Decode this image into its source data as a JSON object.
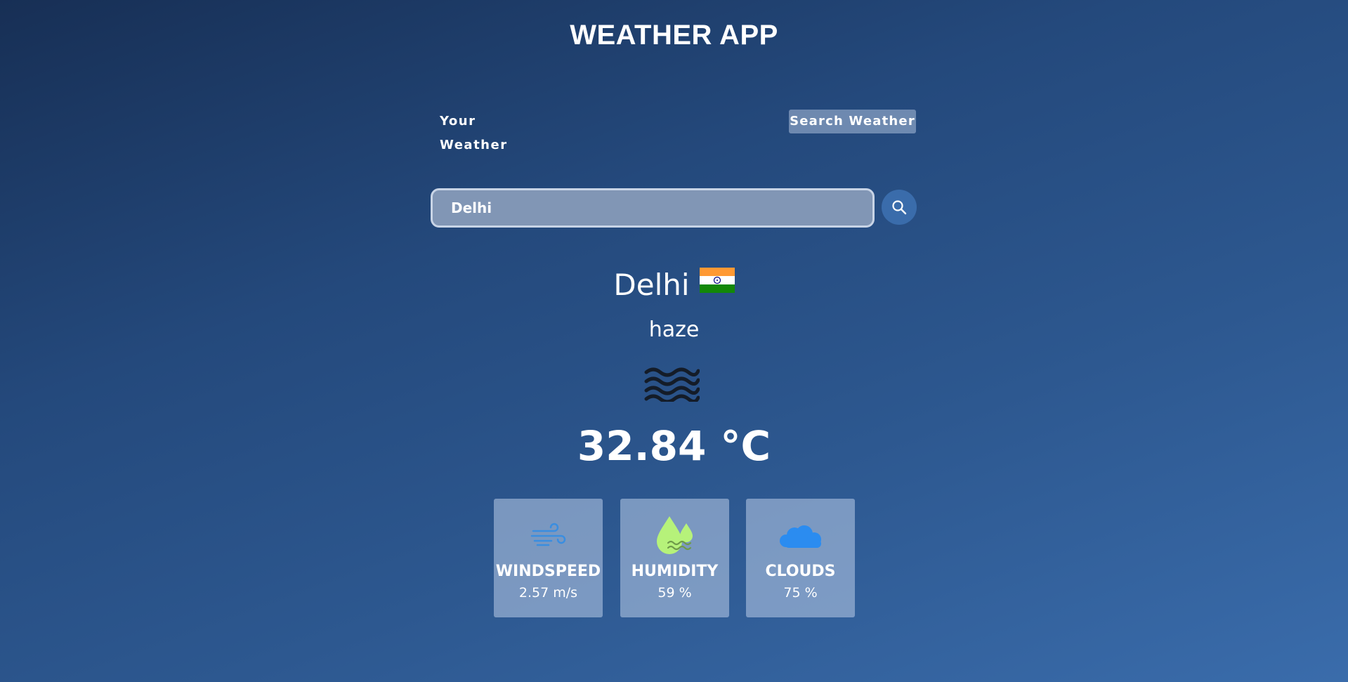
{
  "header": {
    "title": "WEATHER APP"
  },
  "tabs": {
    "your_weather": "Your Weather",
    "search_weather": "Search Weather"
  },
  "search": {
    "value": "Delhi",
    "placeholder": "Search for city..."
  },
  "weather": {
    "city": "Delhi",
    "country_flag": "🇮🇳",
    "description": "haze",
    "icon": "haze-icon",
    "temperature": "32.84 °C"
  },
  "stats": [
    {
      "label": "WINDSPEED",
      "value": "2.57 m/s",
      "icon": "wind-icon"
    },
    {
      "label": "HUMIDITY",
      "value": "59 %",
      "icon": "humidity-icon"
    },
    {
      "label": "CLOUDS",
      "value": "75 %",
      "icon": "cloud-icon"
    }
  ],
  "colors": {
    "background_top": "#172f55",
    "background_bottom": "#3a6cab",
    "search_button": "#3a6cab",
    "wind_icon": "#3a8ee0",
    "humidity_icon": "#b6f27a",
    "cloud_icon": "#2b8cf0"
  }
}
